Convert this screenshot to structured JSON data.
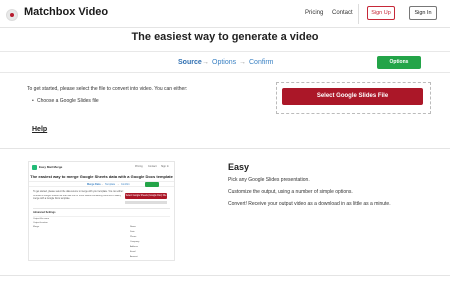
{
  "header": {
    "brand": "Matchbox Video",
    "nav": {
      "pricing": "Pricing",
      "contact": "Contact"
    },
    "sign_up": "Sign Up",
    "sign_in": "Sign In"
  },
  "title": "The easiest way to generate a video",
  "steps": {
    "source": "Source",
    "options": "Options",
    "confirm": "Confirm",
    "arrow": "→"
  },
  "options_button": "Options",
  "intro": "To get started, please select the file to convert into video. You can either:",
  "choices": [
    "Choose a Google Slides file"
  ],
  "select_button": "Select Google Slides File",
  "help_link": "Help",
  "preview": {
    "brand": "Easy Mail Merge",
    "nav": [
      "Pricing",
      "Contact",
      "Sign In"
    ],
    "title": "The easiest way to merge Google Sheets data with a Google Docs template",
    "steps": [
      "Merge Data",
      "→",
      "Template",
      "→",
      "Confirm"
    ],
    "text_lines": [
      "To get started, please select the data source to merge with your template. You can either:",
      "Choose a Google Sheets file that has one or more sheets containing columns of data you'd like to",
      "merge with a Google Docs template."
    ],
    "select_button": "Select Google Sheets (Google Doc) File",
    "panel_header": "Advanced Settings",
    "rows_left": [
      "Output file name",
      "Output location",
      "Merge"
    ],
    "rows_right": [
      "Name",
      "Date",
      "Phone",
      "Company",
      "Address",
      "Email",
      "Amount"
    ]
  },
  "easy": {
    "title": "Easy",
    "lines": [
      "Pick any Google Slides presentation.",
      "Customize the output, using a number of simple options.",
      "Convert! Receive your output video as a download in as little as a minute."
    ]
  },
  "colors": {
    "brand_red": "#ab1728",
    "signup_red": "#c62838",
    "options_green": "#23a448",
    "step_blue": "#3b82c4"
  }
}
